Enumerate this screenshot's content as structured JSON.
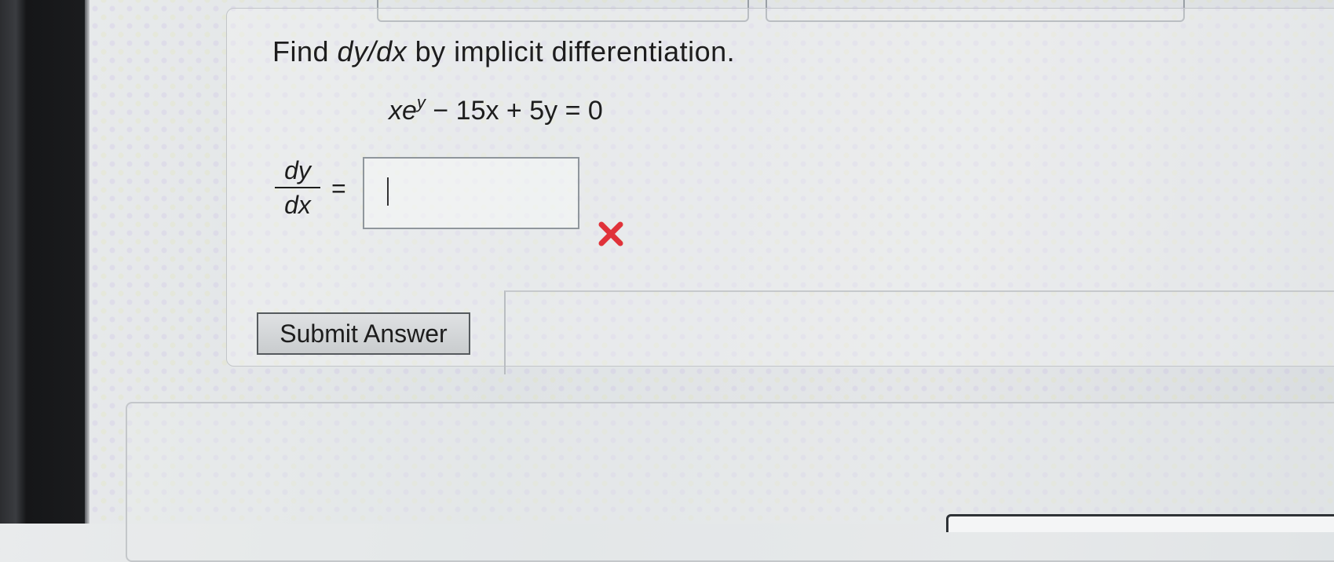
{
  "question": {
    "prefix": "Find",
    "derivative": "dy/dx",
    "suffix": "by implicit differentiation."
  },
  "equation": {
    "base": "xe",
    "exponent": "y",
    "rest": " − 15x + 5y = 0"
  },
  "answer": {
    "lhs_numerator": "dy",
    "lhs_denominator": "dx",
    "equals": "=",
    "value": "",
    "status": "incorrect",
    "status_color": "#e0323a"
  },
  "submit": {
    "label": "Submit Answer"
  }
}
